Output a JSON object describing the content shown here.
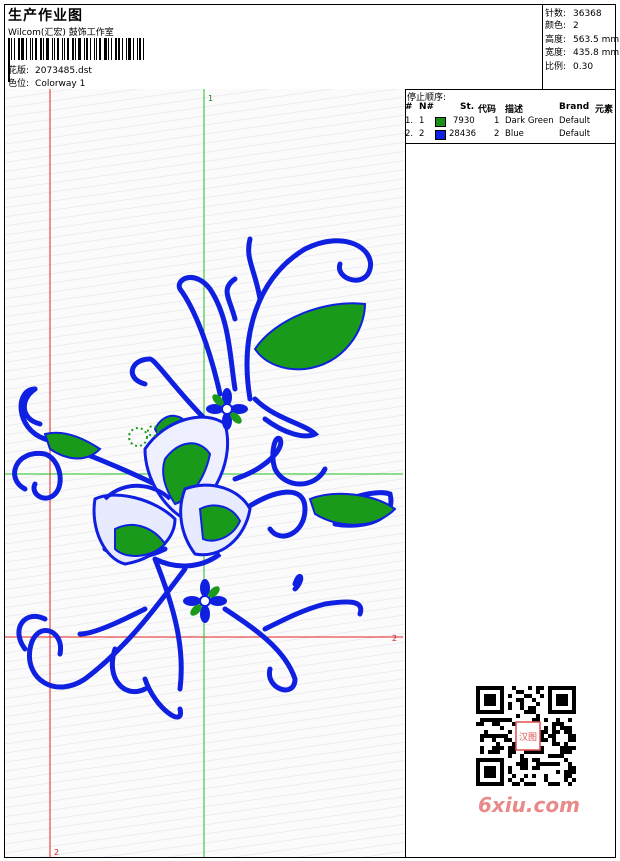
{
  "header": {
    "title": "生产作业图",
    "company": "Wilcom(汇宏) 鼓饰工作室",
    "design_label": "花版:",
    "design_value": "2073485.dst",
    "color_label": "色位:",
    "color_value": "Colorway 1"
  },
  "stats": {
    "stitches_label": "针数:",
    "stitches_value": "36368",
    "colors_label": "颜色:",
    "colors_value": "2",
    "height_label": "高度:",
    "height_value": "563.5 mm",
    "width_label": "宽度:",
    "width_value": "435.8 mm",
    "scale_label": "比例:",
    "scale_value": "0.30"
  },
  "stop_sequence": {
    "title": "停止顺序:",
    "columns": [
      "#",
      "N#",
      "St.",
      "代码",
      "描述",
      "Brand",
      "元素"
    ],
    "rows": [
      {
        "index": "1.",
        "n": "1",
        "stitches": "7930",
        "code": "1",
        "description": "Dark Green",
        "brand": "Default",
        "color": "#1a8f1a"
      },
      {
        "index": "2.",
        "n": "2",
        "stitches": "28436",
        "code": "2",
        "description": "Blue",
        "brand": "Default",
        "color": "#1020e0"
      }
    ]
  },
  "canvas": {
    "marker_top": "1",
    "marker_right": "2",
    "marker_bottom": "2",
    "guide_red": "#e02020",
    "guide_green": "#20c020",
    "thread_blue": "#1020e0",
    "thread_green": "#1a9a1a"
  },
  "watermark": {
    "site": "6xiu.com",
    "stamp": "汉图"
  }
}
